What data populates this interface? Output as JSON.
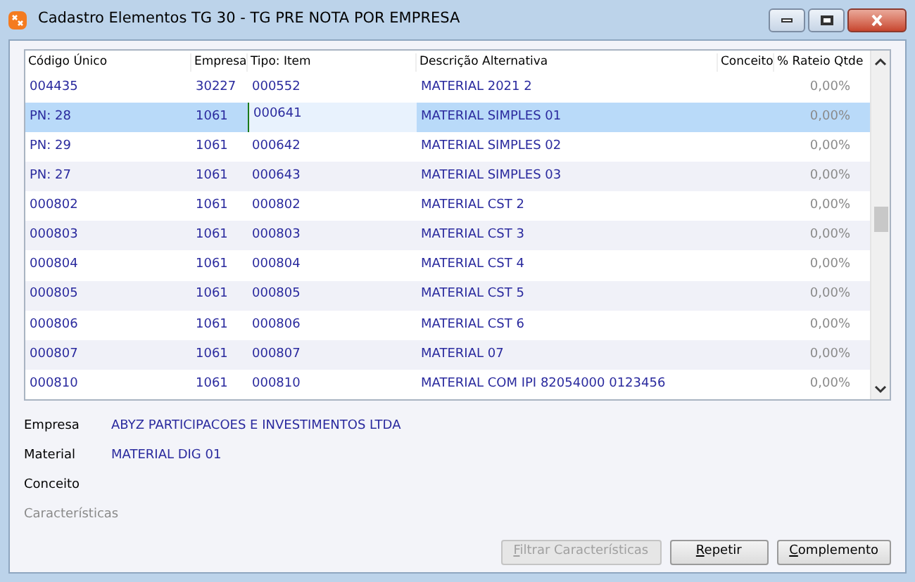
{
  "window": {
    "title": "Cadastro Elementos TG 30 - TG PRE NOTA POR EMPRESA"
  },
  "table": {
    "columns": [
      "Código Único",
      "Empresa",
      "Tipo: Item",
      "Descrição Alternativa",
      "Conceito",
      "% Rateio Qtde"
    ],
    "rows": [
      {
        "code": "004435",
        "company": "30227",
        "item": "000552",
        "description": "MATERIAL 2021 2",
        "ratio": "0,00%",
        "selected": false,
        "editing": false
      },
      {
        "code": "PN: 28",
        "company": "1061",
        "item": "000641",
        "description": "MATERIAL SIMPLES 01",
        "ratio": "0,00%",
        "selected": true,
        "editing": true
      },
      {
        "code": "PN: 29",
        "company": "1061",
        "item": "000642",
        "description": "MATERIAL SIMPLES 02",
        "ratio": "0,00%",
        "selected": false,
        "editing": false
      },
      {
        "code": "PN: 27",
        "company": "1061",
        "item": "000643",
        "description": "MATERIAL SIMPLES 03",
        "ratio": "0,00%",
        "selected": false,
        "editing": false
      },
      {
        "code": "000802",
        "company": "1061",
        "item": "000802",
        "description": "MATERIAL CST 2",
        "ratio": "0,00%",
        "selected": false,
        "editing": false
      },
      {
        "code": "000803",
        "company": "1061",
        "item": "000803",
        "description": "MATERIAL CST 3",
        "ratio": "0,00%",
        "selected": false,
        "editing": false
      },
      {
        "code": "000804",
        "company": "1061",
        "item": "000804",
        "description": "MATERIAL CST 4",
        "ratio": "0,00%",
        "selected": false,
        "editing": false
      },
      {
        "code": "000805",
        "company": "1061",
        "item": "000805",
        "description": "MATERIAL CST 5",
        "ratio": "0,00%",
        "selected": false,
        "editing": false
      },
      {
        "code": "000806",
        "company": "1061",
        "item": "000806",
        "description": "MATERIAL CST 6",
        "ratio": "0,00%",
        "selected": false,
        "editing": false
      },
      {
        "code": "000807",
        "company": "1061",
        "item": "000807",
        "description": "MATERIAL 07",
        "ratio": "0,00%",
        "selected": false,
        "editing": false
      },
      {
        "code": "000810",
        "company": "1061",
        "item": "000810",
        "description": "MATERIAL COM IPI  82054000  0123456",
        "ratio": "0,00%",
        "selected": false,
        "editing": false
      }
    ]
  },
  "details": [
    {
      "label": "Empresa",
      "value": "ABYZ PARTICIPACOES E INVESTIMENTOS LTDA",
      "disabled": false
    },
    {
      "label": "Material",
      "value": "MATERIAL DIG 01",
      "disabled": false
    },
    {
      "label": "Conceito",
      "disabled": false
    },
    {
      "label": "Características",
      "disabled": true
    }
  ],
  "buttons": [
    {
      "label": "Filtrar Características",
      "disabled": true
    },
    {
      "label": "Repetir",
      "disabled": false
    },
    {
      "label": "Complemento",
      "disabled": false
    }
  ]
}
